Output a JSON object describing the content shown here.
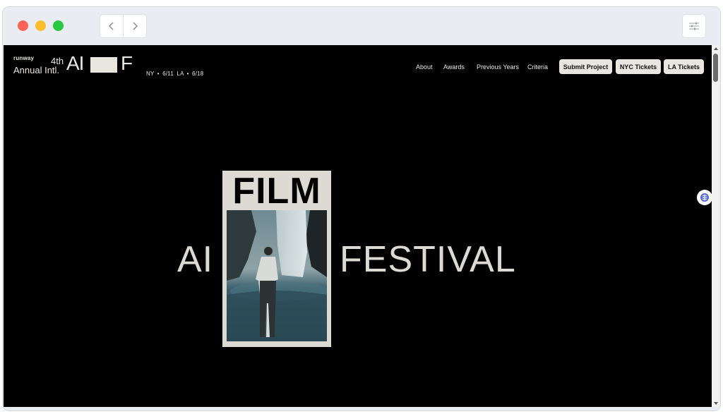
{
  "browser": {
    "controls": [
      "close",
      "minimize",
      "maximize"
    ],
    "icons": {
      "back": "chevron-left-icon",
      "forward": "chevron-right-icon",
      "settings": "sliders-icon"
    }
  },
  "site": {
    "brand": {
      "runway": "runway",
      "annual": "Annual Intl.",
      "edition": "4th",
      "ai": "AI",
      "f": "F",
      "dates": "NY • 6/11  LA • 6/18"
    },
    "nav": {
      "links": [
        "About",
        "Awards",
        "Previous Years",
        "Criteria"
      ],
      "buttons": [
        "Submit Project",
        "NYC Tickets",
        "LA Tickets"
      ]
    },
    "hero": {
      "ai": "AI",
      "film": "FILM",
      "festival": "FESTIVAL"
    }
  },
  "colors": {
    "background": "#000000",
    "text": "#e8e6df",
    "poster": "#dcdad3"
  }
}
